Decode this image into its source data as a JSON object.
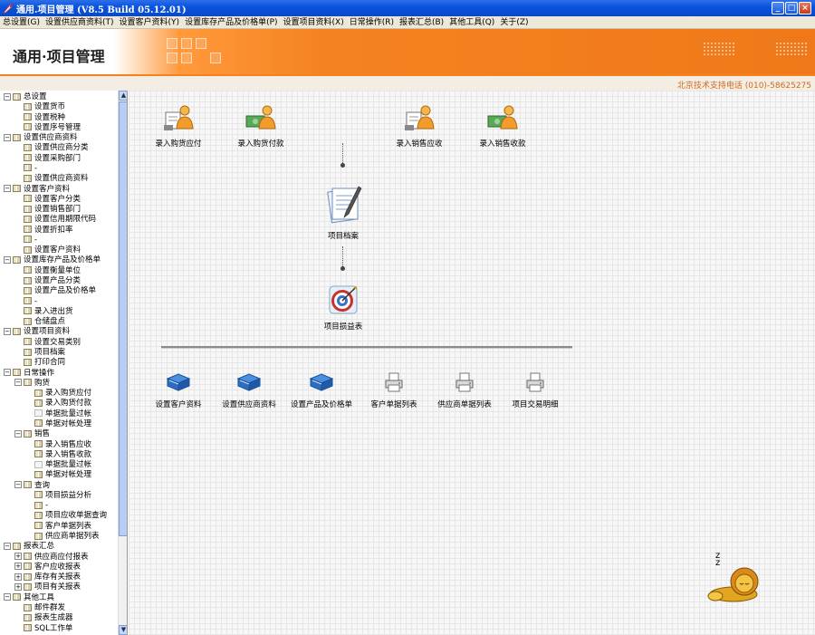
{
  "window": {
    "title": "通用.项目管理  (V8.5 Build 05.12.01)",
    "buttons": {
      "minimize": "_",
      "maximize": "□",
      "close": "×"
    }
  },
  "menubar": [
    "总设置(G)",
    "设置供应商资料(T)",
    "设置客户资料(Y)",
    "设置库存产品及价格单(P)",
    "设置项目资料(X)",
    "日常操作(R)",
    "报表汇总(B)",
    "其他工具(Q)",
    "关于(Z)"
  ],
  "banner": {
    "title": "通用·项目管理",
    "support_phone": "北京技术支持电话 (010)-58625275"
  },
  "tree": [
    {
      "level": 0,
      "toggle": "−",
      "label": "总设置"
    },
    {
      "level": 1,
      "label": "设置货币"
    },
    {
      "level": 1,
      "label": "设置税种"
    },
    {
      "level": 1,
      "label": "设置序号管理"
    },
    {
      "level": 0,
      "toggle": "−",
      "label": "设置供应商资料"
    },
    {
      "level": 1,
      "label": "设置供应商分类"
    },
    {
      "level": 1,
      "label": "设置采购部门"
    },
    {
      "level": 1,
      "label": "-"
    },
    {
      "level": 1,
      "label": "设置供应商资料"
    },
    {
      "level": 0,
      "toggle": "−",
      "label": "设置客户资料"
    },
    {
      "level": 1,
      "label": "设置客户分类"
    },
    {
      "level": 1,
      "label": "设置销售部门"
    },
    {
      "level": 1,
      "label": "设置信用期限代码"
    },
    {
      "level": 1,
      "label": "设置折扣率"
    },
    {
      "level": 1,
      "label": "-"
    },
    {
      "level": 1,
      "label": "设置客户资料"
    },
    {
      "level": 0,
      "toggle": "−",
      "label": "设置库存产品及价格单"
    },
    {
      "level": 1,
      "label": "设置衡量单位"
    },
    {
      "level": 1,
      "label": "设置产品分类"
    },
    {
      "level": 1,
      "label": "设置产品及价格单"
    },
    {
      "level": 1,
      "label": "-"
    },
    {
      "level": 1,
      "label": "录入进出货"
    },
    {
      "level": 1,
      "label": "仓储盘点"
    },
    {
      "level": 0,
      "toggle": "−",
      "label": "设置项目资料"
    },
    {
      "level": 1,
      "label": "设置交易类别"
    },
    {
      "level": 1,
      "label": "项目档案"
    },
    {
      "level": 1,
      "label": "打印合同"
    },
    {
      "level": 0,
      "toggle": "−",
      "label": "日常操作"
    },
    {
      "level": 1,
      "toggle": "−",
      "label": "购货"
    },
    {
      "level": 2,
      "label": "录入购货应付"
    },
    {
      "level": 2,
      "label": "录入购货付款"
    },
    {
      "level": 2,
      "label": "单据批量过帐",
      "blank": true
    },
    {
      "level": 2,
      "label": "单据对帐处理"
    },
    {
      "level": 1,
      "toggle": "−",
      "label": "销售"
    },
    {
      "level": 2,
      "label": "录入销售应收"
    },
    {
      "level": 2,
      "label": "录入销售收款"
    },
    {
      "level": 2,
      "label": "单据批量过帐",
      "blank": true
    },
    {
      "level": 2,
      "label": "单据对帐处理"
    },
    {
      "level": 1,
      "toggle": "−",
      "label": "查询"
    },
    {
      "level": 2,
      "label": "项目损益分析"
    },
    {
      "level": 2,
      "label": "-"
    },
    {
      "level": 2,
      "label": "项目应收单据查询"
    },
    {
      "level": 2,
      "label": "客户单据列表"
    },
    {
      "level": 2,
      "label": "供应商单据列表"
    },
    {
      "level": 0,
      "toggle": "−",
      "label": "报表汇总"
    },
    {
      "level": 1,
      "toggle": "+",
      "label": "供应商应付报表"
    },
    {
      "level": 1,
      "toggle": "+",
      "label": "客户应收报表"
    },
    {
      "level": 1,
      "toggle": "+",
      "label": "库存有关报表"
    },
    {
      "level": 1,
      "toggle": "+",
      "label": "项目有关报表"
    },
    {
      "level": 0,
      "toggle": "−",
      "label": "其他工具"
    },
    {
      "level": 1,
      "label": "邮件群发"
    },
    {
      "level": 1,
      "label": "报表生成器"
    },
    {
      "level": 1,
      "label": "SQL工作单"
    }
  ],
  "flow": {
    "purchase_payable": "录入购货应付",
    "purchase_payment": "录入购货付款",
    "sales_receivable": "录入销售应收",
    "sales_receipt": "录入销售收款",
    "project_archive": "项目档案",
    "project_profit": "项目损益表"
  },
  "shortcuts": [
    {
      "label": "设置客户资料",
      "icon": "book-icon"
    },
    {
      "label": "设置供应商资料",
      "icon": "book-icon"
    },
    {
      "label": "设置产品及价格单",
      "icon": "book-icon"
    },
    {
      "label": "客户单据列表",
      "icon": "printer-icon"
    },
    {
      "label": "供应商单据列表",
      "icon": "printer-icon"
    },
    {
      "label": "项目交易明细",
      "icon": "printer-icon"
    }
  ],
  "mascot": {
    "snore": "z\nz"
  },
  "colors": {
    "accent": "#f58220",
    "titlebar": "#0a54e0",
    "phone_text": "#d2691e"
  }
}
